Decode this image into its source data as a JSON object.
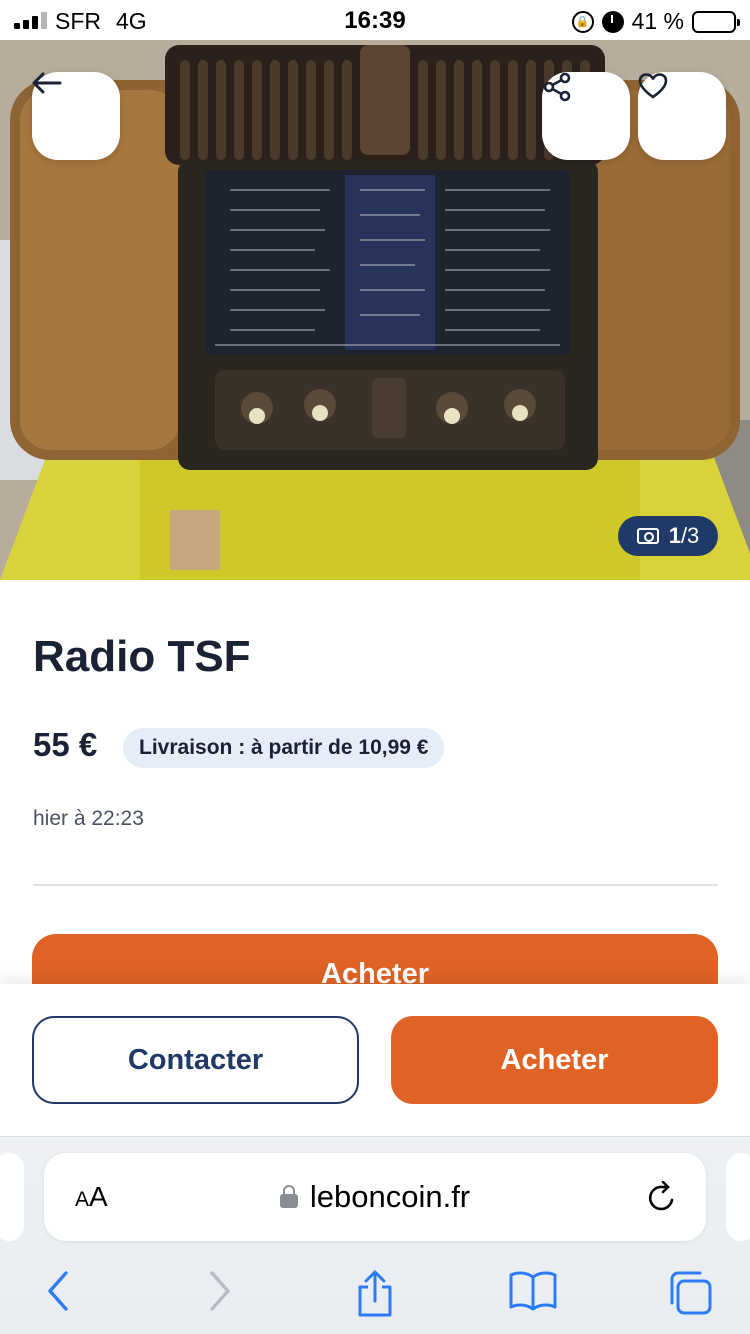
{
  "status_bar": {
    "carrier": "SFR",
    "network": "4G",
    "time": "16:39",
    "battery": "41 %",
    "battery_level": 0.41
  },
  "photo": {
    "counter_current": "1",
    "counter_total": "/3",
    "back_icon": "arrow-left-icon",
    "share_icon": "share-icon",
    "favorite_icon": "heart-icon"
  },
  "listing": {
    "title": "Radio TSF",
    "price": "55 €",
    "delivery": "Livraison : à partir de 10,99 €",
    "date": "hier à 22:23",
    "buy_label": "Acheter"
  },
  "action_bar": {
    "contact_label": "Contacter",
    "buy_label": "Acheter"
  },
  "browser": {
    "text_size_label_small": "A",
    "text_size_label_large": "A",
    "url": "leboncoin.fr"
  },
  "colors": {
    "accent": "#e06326",
    "brand_navy": "#1f3a66",
    "delivery_badge_bg": "#e4edf8"
  }
}
